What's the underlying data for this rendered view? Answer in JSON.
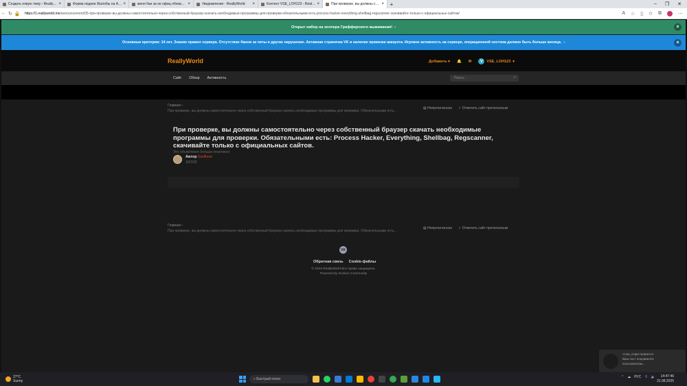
{
  "browser": {
    "tabs": [
      {
        "title": "Создать новую тему › ReallyWo",
        "active": false
      },
      {
        "title": "Форма подачи Жалобы на Адм",
        "active": false
      },
      {
        "title": "меня бан за не офиц обновлени",
        "active": false
      },
      {
        "title": "Уведомления - ReallyWorld",
        "active": false
      },
      {
        "title": "Контент VSE_LOH123 - ReallyW",
        "active": false
      },
      {
        "title": "При проверке, вы должны само",
        "active": true
      }
    ],
    "url_host": "https://1.reallyworld.me",
    "url_path": "/announcement/35-при-проверке-вы-должны-самостоятельно-через-собственный-браузер-скачать-необходимые-программы-для-проверки-обязательными-есть-process-hacker-everything-shellbag-regscanner-скачивайте-только-с-официальных-сайтов/"
  },
  "announcements": {
    "green": "Открыт набор на хелпера Грифферского выживания!",
    "blue": "Основные критерии: 14 лет. Знание правил сервера. Отсутствие банов за читы и другие нарушение. Активная страничка VK и наличие привязки аккаунта. Игровое активность на сервере, операционной система должно быть больше месяца."
  },
  "header": {
    "brand": "ReallyWorld",
    "add_label": "Добавить",
    "username": "VSE_LOH123",
    "avatar_letter": "V"
  },
  "nav": {
    "links": [
      "Сайт",
      "Обзор",
      "Активность"
    ],
    "search_placeholder": "Поиск..."
  },
  "breadcrumb": {
    "home": "Главная",
    "current": "При проверке, вы должны самостоятельно через собственный браузер скачать необходимые программы для проверки. Обязательными есть...",
    "unread": "Непрочитанное",
    "mark_read": "Отметить сайт прочитанным"
  },
  "announcement": {
    "title": "При проверке, вы должны самостоятельно через собственный браузер скачать необходимые программы для проверки. Обязательными есть: Process Hacker, Everything, Shellbag, Regscanner, скачивайте только с официальных сайтов.",
    "inactive_note": "Это объявление больше неактивно",
    "author_prefix": "Автор",
    "author_name": "Sorillson",
    "date": "10/7/22"
  },
  "footer": {
    "vk": "VK",
    "feedback": "Обратная связь",
    "cookies": "Cookie-файлы",
    "copyright": "© 2024 ReallyWorld Все права защищены.",
    "powered": "Powered by Invision Community"
  },
  "toast": {
    "line1": "Атом_Сири Нравится",
    "line2": "Ваш пост понравился",
    "line3": "пользователю..."
  },
  "taskbar": {
    "temp": "27°C",
    "weather": "Sunny",
    "search": "Быстрый поиск",
    "lang": "РУС",
    "time": "14:47:46",
    "date": "31.08.2025"
  }
}
